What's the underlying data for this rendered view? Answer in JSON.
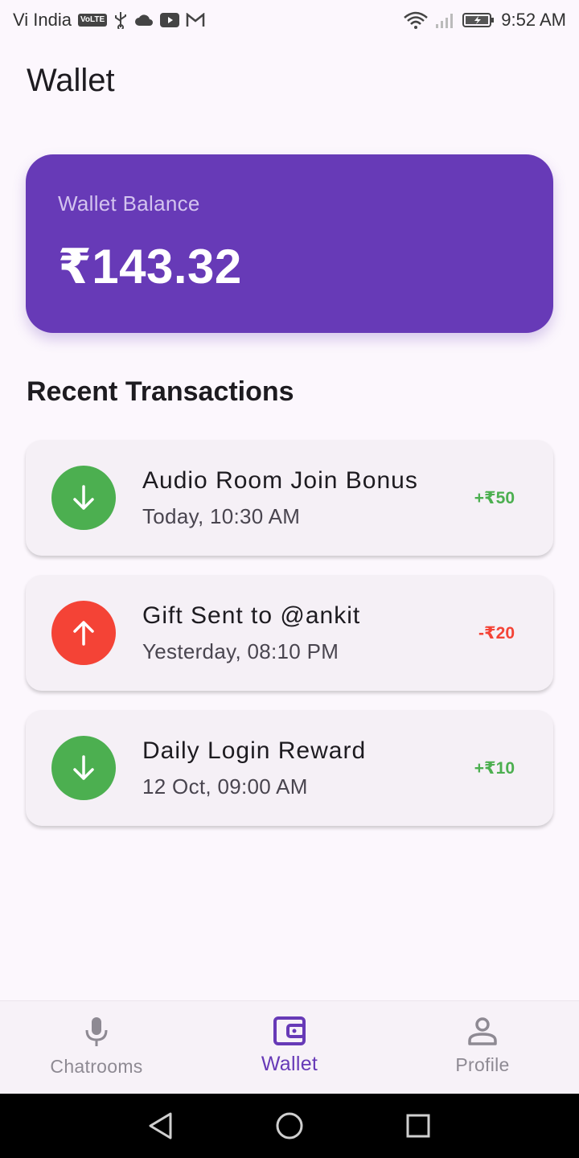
{
  "status_bar": {
    "carrier": "Vi India",
    "volte": "VoLTE",
    "time": "9:52 AM"
  },
  "header": {
    "title": "Wallet"
  },
  "balance": {
    "label": "Wallet Balance",
    "amount": "₹143.32"
  },
  "transactions": {
    "title": "Recent Transactions",
    "items": [
      {
        "title": "Audio Room Join Bonus",
        "time": "Today, 10:30 AM",
        "amount": "+₹50",
        "type": "credit",
        "icon": "arrow-down-icon",
        "color": "#4caf50"
      },
      {
        "title": "Gift Sent to @ankit",
        "time": "Yesterday, 08:10 PM",
        "amount": "-₹20",
        "type": "debit",
        "icon": "arrow-up-icon",
        "color": "#f44336"
      },
      {
        "title": "Daily Login Reward",
        "time": "12 Oct, 09:00 AM",
        "amount": "+₹10",
        "type": "credit",
        "icon": "arrow-down-icon",
        "color": "#4caf50"
      }
    ]
  },
  "bottom_nav": {
    "items": [
      {
        "label": "Chatrooms",
        "icon": "microphone-icon",
        "active": false
      },
      {
        "label": "Wallet",
        "icon": "wallet-icon",
        "active": true
      },
      {
        "label": "Profile",
        "icon": "person-icon",
        "active": false
      }
    ]
  },
  "colors": {
    "accent": "#673ab7",
    "credit": "#4caf50",
    "debit": "#f44336",
    "background": "#fcf7fd"
  }
}
